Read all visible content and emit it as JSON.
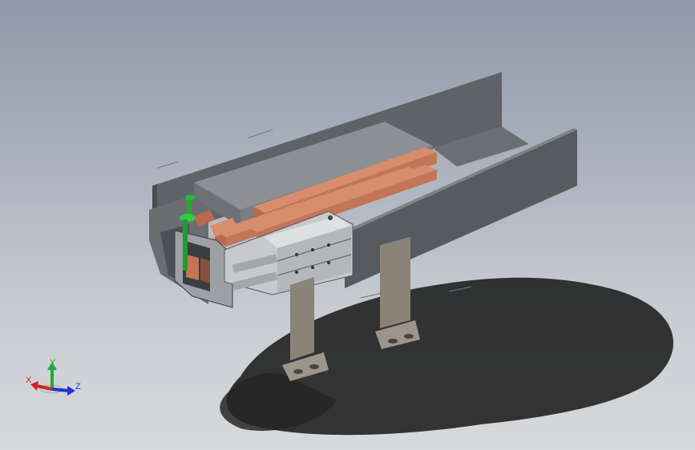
{
  "triad": {
    "x_label": "X",
    "y_label": "Y",
    "z_label": "Z",
    "x_color": "#d42222",
    "y_color": "#22aa33",
    "z_color": "#2233cc"
  },
  "scene": {
    "background_top": "#8f99a9",
    "background_bottom": "#d7d9dc",
    "trough_color": "#5d6166",
    "copper_color": "#c9765a",
    "bracket_color": "#8a8378",
    "probe_color": "#22bb33"
  }
}
